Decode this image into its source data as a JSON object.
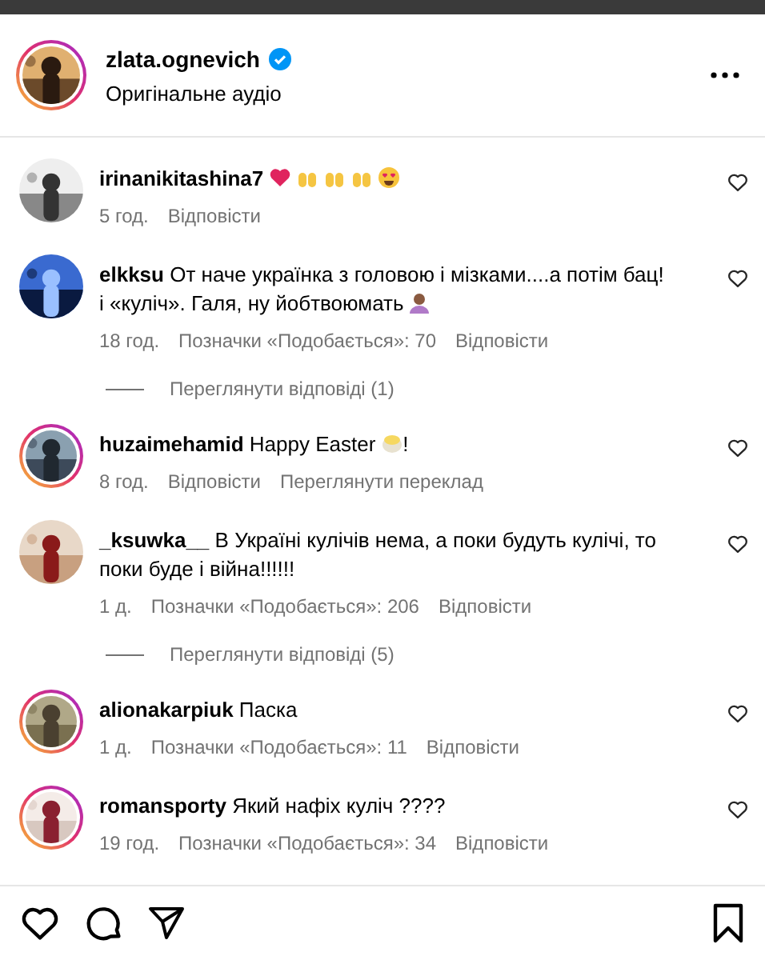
{
  "post": {
    "author": "zlata.ognevich",
    "verified": true,
    "story_ring": true,
    "audio": "Оригінальне аудіо"
  },
  "comments": [
    {
      "user": "irinanikitashina7",
      "emojis": [
        {
          "kind": "heart"
        },
        {
          "kind": "hands"
        },
        {
          "kind": "hands"
        },
        {
          "kind": "hands"
        },
        {
          "kind": "heart-eyes"
        }
      ],
      "story_ring": false,
      "time": "5 год.",
      "reply": "Відповісти"
    },
    {
      "user": "elkksu",
      "text": "От наче українка з головою і мізками....а потім бац! і «куліч». Галя, ну йобтвоюмать",
      "emojis": [
        {
          "kind": "person"
        }
      ],
      "story_ring": false,
      "time": "18 год.",
      "likes": "Позначки «Подобається»: 70",
      "reply": "Відповісти",
      "view_replies": "Переглянути відповіді (1)"
    },
    {
      "user": "huzaimehamid",
      "text": "Happy Easter",
      "emojis": [
        {
          "kind": "cake"
        }
      ],
      "tail": "!",
      "story_ring": true,
      "time": "8 год.",
      "reply": "Відповісти",
      "translate": "Переглянути переклад"
    },
    {
      "user": "_ksuwka__",
      "text": "В Україні кулічів нема, а поки будуть кулічі, то поки буде і війна!!!!!!",
      "story_ring": false,
      "time": "1 д.",
      "likes": "Позначки «Подобається»: 206",
      "reply": "Відповісти",
      "view_replies": "Переглянути відповіді (5)"
    },
    {
      "user": "alionakarpiuk",
      "text": "Паска",
      "story_ring": true,
      "time": "1 д.",
      "likes": "Позначки «Подобається»: 11",
      "reply": "Відповісти"
    },
    {
      "user": "romansporty",
      "text": "Який нафіх куліч ????",
      "story_ring": true,
      "time": "19 год.",
      "likes": "Позначки «Подобається»: 34",
      "reply": "Відповісти"
    }
  ]
}
